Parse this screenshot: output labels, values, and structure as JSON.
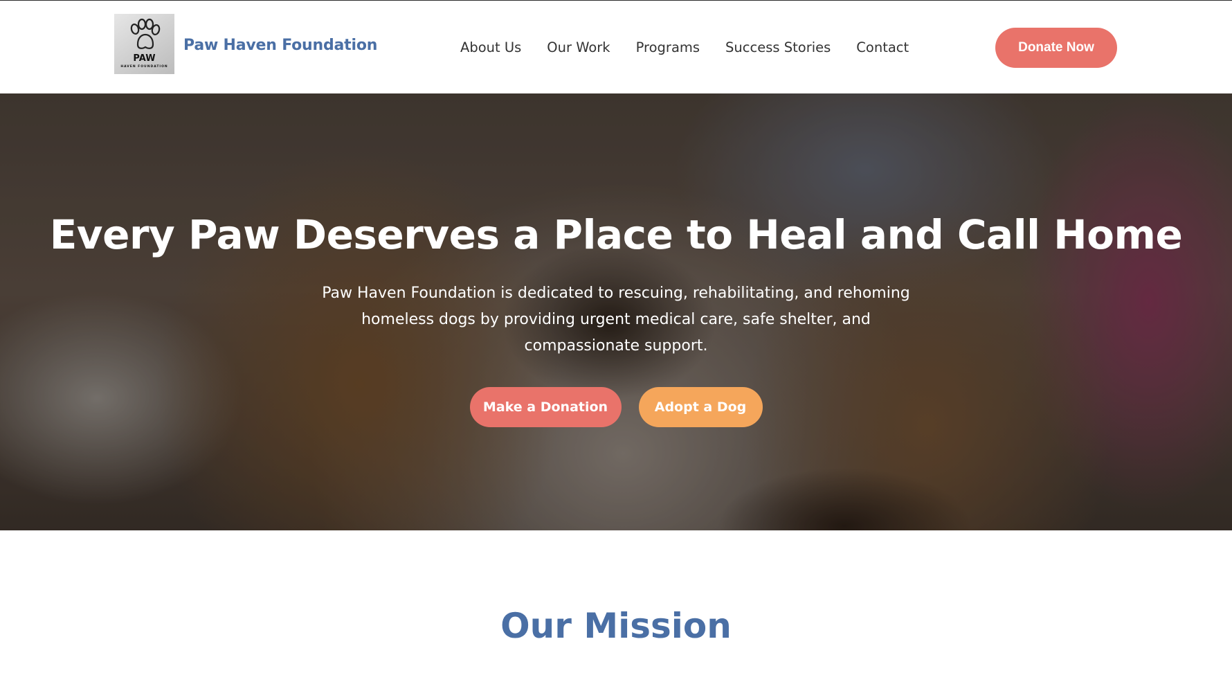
{
  "brand": {
    "logo_text": "PAW",
    "logo_subtext": "HAVEN FOUNDATION",
    "name": "Paw Haven Foundation"
  },
  "nav": {
    "items": [
      "About Us",
      "Our Work",
      "Programs",
      "Success Stories",
      "Contact"
    ],
    "donate_label": "Donate Now"
  },
  "hero": {
    "title": "Every Paw Deserves a Place to Heal and Call Home",
    "description": "Paw Haven Foundation is dedicated to rescuing, rehabilitating, and rehoming homeless dogs by providing urgent medical care, safe shelter, and compassionate support.",
    "primary_button": "Make a Donation",
    "secondary_button": "Adopt a Dog",
    "background_image": "dog-photo"
  },
  "mission": {
    "title": "Our Mission"
  },
  "colors": {
    "brand_blue": "#4a6fa5",
    "coral": "#e9736a",
    "orange": "#f5a65b"
  }
}
